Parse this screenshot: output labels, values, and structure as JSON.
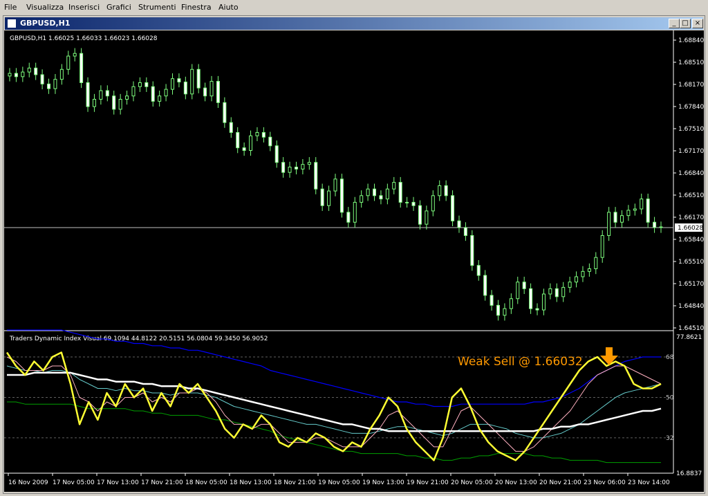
{
  "menu": [
    "File",
    "Visualizza",
    "Inserisci",
    "Grafici",
    "Strumenti",
    "Finestra",
    "Aiuto"
  ],
  "window": {
    "title": "GBPUSD,H1",
    "min_glyph": "_",
    "max_glyph": "□",
    "close_glyph": "×"
  },
  "colors": {
    "bull": "#7fff7f",
    "bear": "#ffffff",
    "yellow": "#ffff33",
    "blue": "#0000ff",
    "green": "#00a000",
    "cyan": "#66cccc",
    "pink": "#ffb0c0",
    "white": "#ffffff",
    "annotation": "#ff9900"
  },
  "price_panel": {
    "header": "GBPUSD,H1  1.66025 1.66033 1.66023 1.66028",
    "current_price": "1.66028",
    "ticks": [
      "1.68840",
      "1.68510",
      "1.68170",
      "1.67840",
      "1.67510",
      "1.67170",
      "1.66840",
      "1.66510",
      "1.66170",
      "1.65840",
      "1.65510",
      "1.65170",
      "1.64840",
      "1.64510"
    ]
  },
  "indicator_panel": {
    "header": "Traders Dynamic Index Visual 69.1094 44.8122 20.5151 56.0804 59.3450 56.9052",
    "max_label": "77.8621",
    "min_label": "16.8837",
    "levels": [
      "68",
      "50",
      "32"
    ],
    "annotation": "Weak Sell @ 1.66032"
  },
  "chart_data": {
    "type": "candlestick",
    "x_ticks": [
      "16 Nov 2009",
      "17 Nov 05:00",
      "17 Nov 13:00",
      "17 Nov 21:00",
      "18 Nov 05:00",
      "18 Nov 13:00",
      "18 Nov 21:00",
      "19 Nov 05:00",
      "19 Nov 13:00",
      "19 Nov 21:00",
      "20 Nov 05:00",
      "20 Nov 13:00",
      "20 Nov 21:00",
      "23 Nov 06:00",
      "23 Nov 14:00"
    ],
    "price_ylim": [
      1.6451,
      1.6884
    ],
    "indicator_ylim": [
      16.8837,
      77.8621
    ],
    "closes": [
      1.6834,
      1.6829,
      1.6836,
      1.6842,
      1.6832,
      1.6818,
      1.6811,
      1.6825,
      1.684,
      1.686,
      1.6864,
      1.682,
      1.6784,
      1.6795,
      1.6808,
      1.68,
      1.678,
      1.6795,
      1.68,
      1.6814,
      1.682,
      1.6814,
      1.6792,
      1.68,
      1.681,
      1.6826,
      1.6821,
      1.6803,
      1.684,
      1.6812,
      1.68,
      1.6822,
      1.679,
      1.676,
      1.6745,
      1.6722,
      1.6718,
      1.674,
      1.6745,
      1.6738,
      1.6725,
      1.67,
      1.6685,
      1.6693,
      1.669,
      1.6697,
      1.67,
      1.666,
      1.6635,
      1.6657,
      1.6675,
      1.6625,
      1.661,
      1.664,
      1.665,
      1.666,
      1.665,
      1.6645,
      1.666,
      1.667,
      1.664,
      1.664,
      1.6635,
      1.6607,
      1.6627,
      1.665,
      1.6665,
      1.665,
      1.6612,
      1.6602,
      1.659,
      1.6545,
      1.653,
      1.65,
      1.6485,
      1.647,
      1.648,
      1.6495,
      1.652,
      1.651,
      1.648,
      1.6478,
      1.6502,
      1.651,
      1.6498,
      1.6512,
      1.652,
      1.6528,
      1.6536,
      1.654,
      1.6557,
      1.659,
      1.6625,
      1.661,
      1.662,
      1.6628,
      1.663,
      1.6645,
      1.661,
      1.6602,
      1.6603
    ],
    "series": [
      {
        "name": "yellow",
        "values": [
          70,
          64,
          60,
          66,
          62,
          68,
          70,
          56,
          38,
          48,
          40,
          52,
          46,
          56,
          50,
          54,
          44,
          52,
          46,
          56,
          52,
          56,
          50,
          44,
          36,
          32,
          38,
          36,
          42,
          38,
          30,
          28,
          32,
          30,
          34,
          32,
          28,
          26,
          30,
          28,
          36,
          42,
          50,
          46,
          36,
          30,
          26,
          22,
          32,
          50,
          54,
          46,
          36,
          30,
          26,
          24,
          22,
          26,
          32,
          38,
          44,
          50,
          56,
          62,
          66,
          68,
          64,
          66,
          64,
          56,
          54,
          54,
          56
        ]
      },
      {
        "name": "pink",
        "values": [
          68,
          66,
          62,
          62,
          62,
          64,
          64,
          60,
          50,
          48,
          44,
          48,
          46,
          50,
          50,
          52,
          48,
          50,
          48,
          52,
          52,
          54,
          52,
          48,
          42,
          38,
          38,
          36,
          38,
          38,
          34,
          30,
          30,
          30,
          32,
          32,
          30,
          28,
          28,
          28,
          32,
          36,
          42,
          44,
          40,
          36,
          32,
          28,
          28,
          36,
          44,
          46,
          42,
          38,
          34,
          30,
          26,
          26,
          28,
          32,
          36,
          40,
          44,
          50,
          56,
          60,
          62,
          64,
          64,
          62,
          60,
          58,
          56
        ]
      },
      {
        "name": "cyan",
        "values": [
          64,
          63,
          62,
          62,
          61,
          62,
          62,
          61,
          58,
          56,
          54,
          54,
          53,
          54,
          53,
          53,
          52,
          52,
          51,
          52,
          52,
          52,
          51,
          50,
          48,
          46,
          45,
          44,
          43,
          42,
          41,
          40,
          39,
          38,
          38,
          37,
          36,
          35,
          34,
          34,
          34,
          35,
          36,
          37,
          37,
          36,
          35,
          34,
          33,
          34,
          36,
          38,
          38,
          38,
          37,
          36,
          34,
          33,
          32,
          32,
          33,
          34,
          36,
          38,
          41,
          44,
          47,
          50,
          52,
          53,
          54,
          55,
          56
        ]
      },
      {
        "name": "white",
        "values": [
          60,
          60,
          60,
          61,
          61,
          61,
          61,
          61,
          60,
          59,
          58,
          58,
          57,
          57,
          57,
          56,
          56,
          55,
          55,
          55,
          54,
          54,
          53,
          52,
          51,
          50,
          49,
          48,
          47,
          46,
          45,
          44,
          43,
          42,
          41,
          40,
          39,
          38,
          38,
          37,
          36,
          36,
          35,
          35,
          35,
          35,
          35,
          35,
          35,
          35,
          35,
          35,
          35,
          35,
          35,
          35,
          35,
          35,
          35,
          36,
          36,
          37,
          37,
          38,
          38,
          39,
          40,
          41,
          42,
          43,
          44,
          44,
          45
        ]
      },
      {
        "name": "blue",
        "values": [
          80,
          80,
          80,
          80,
          80,
          80,
          80,
          79,
          78,
          77,
          76,
          76,
          75,
          75,
          74,
          74,
          73,
          73,
          72,
          72,
          71,
          71,
          70,
          69,
          68,
          67,
          66,
          65,
          64,
          62,
          61,
          60,
          59,
          58,
          57,
          56,
          55,
          54,
          53,
          52,
          51,
          50,
          49,
          48,
          48,
          47,
          47,
          46,
          46,
          46,
          47,
          47,
          47,
          47,
          47,
          47,
          47,
          47,
          48,
          48,
          49,
          50,
          52,
          54,
          57,
          60,
          62,
          64,
          66,
          67,
          68,
          68,
          68
        ]
      },
      {
        "name": "green",
        "values": [
          48,
          48,
          47,
          47,
          47,
          47,
          47,
          47,
          46,
          45,
          45,
          45,
          45,
          45,
          44,
          44,
          43,
          43,
          42,
          42,
          42,
          42,
          41,
          40,
          40,
          39,
          38,
          37,
          36,
          35,
          33,
          32,
          31,
          30,
          29,
          28,
          27,
          26,
          26,
          25,
          25,
          25,
          25,
          25,
          24,
          24,
          23,
          23,
          22,
          22,
          23,
          23,
          24,
          24,
          25,
          25,
          25,
          25,
          24,
          24,
          23,
          23,
          22,
          22,
          22,
          22,
          21,
          21,
          21,
          21,
          21,
          21,
          21
        ]
      }
    ]
  }
}
